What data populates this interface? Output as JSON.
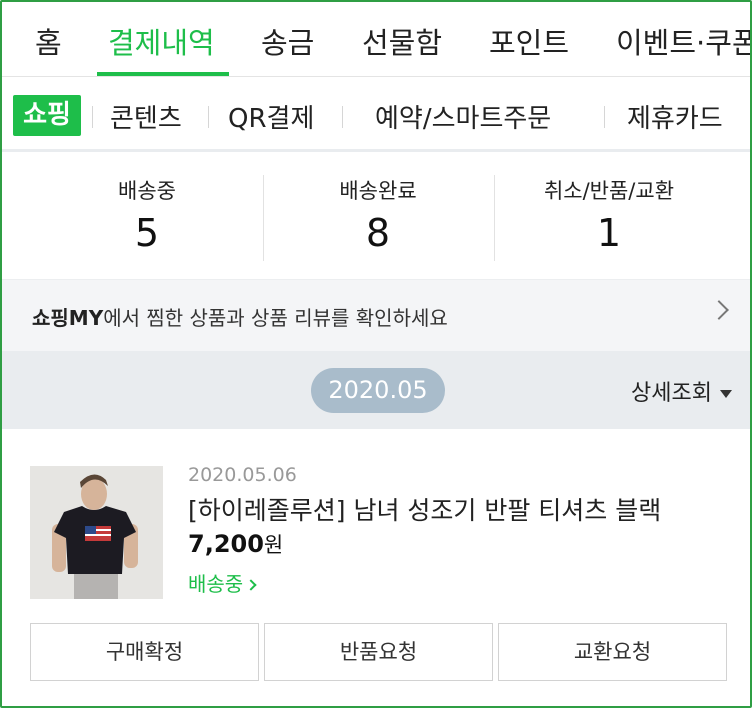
{
  "top_nav": {
    "tabs": [
      "홈",
      "결제내역",
      "송금",
      "선물함",
      "포인트",
      "이벤트·쿠폰"
    ],
    "active_index": 1
  },
  "sub_nav": {
    "items": [
      "쇼핑",
      "콘텐츠",
      "QR결제",
      "예약/스마트주문",
      "제휴카드"
    ],
    "active_index": 0
  },
  "stats": [
    {
      "label": "배송중",
      "count": "5"
    },
    {
      "label": "배송완료",
      "count": "8"
    },
    {
      "label": "취소/반품/교환",
      "count": "1"
    }
  ],
  "banner": {
    "bold": "쇼핑MY",
    "text": "에서 찜한 상품과 상품 리뷰를 확인하세요"
  },
  "date_bar": {
    "month": "2020.05",
    "detail_label": "상세조회"
  },
  "order": {
    "date": "2020.05.06",
    "name": "[하이레졸루션] 남녀 성조기 반팔 티셔츠 블랙",
    "price": "7,200",
    "currency": "원",
    "status": "배송중",
    "buttons": [
      "구매확정",
      "반품요청",
      "교환요청"
    ]
  },
  "colors": {
    "accent": "#1ebe4a",
    "date_pill": "#a9bccb",
    "date_bar_bg": "#e9ecef",
    "banner_bg": "#f4f5f7"
  }
}
